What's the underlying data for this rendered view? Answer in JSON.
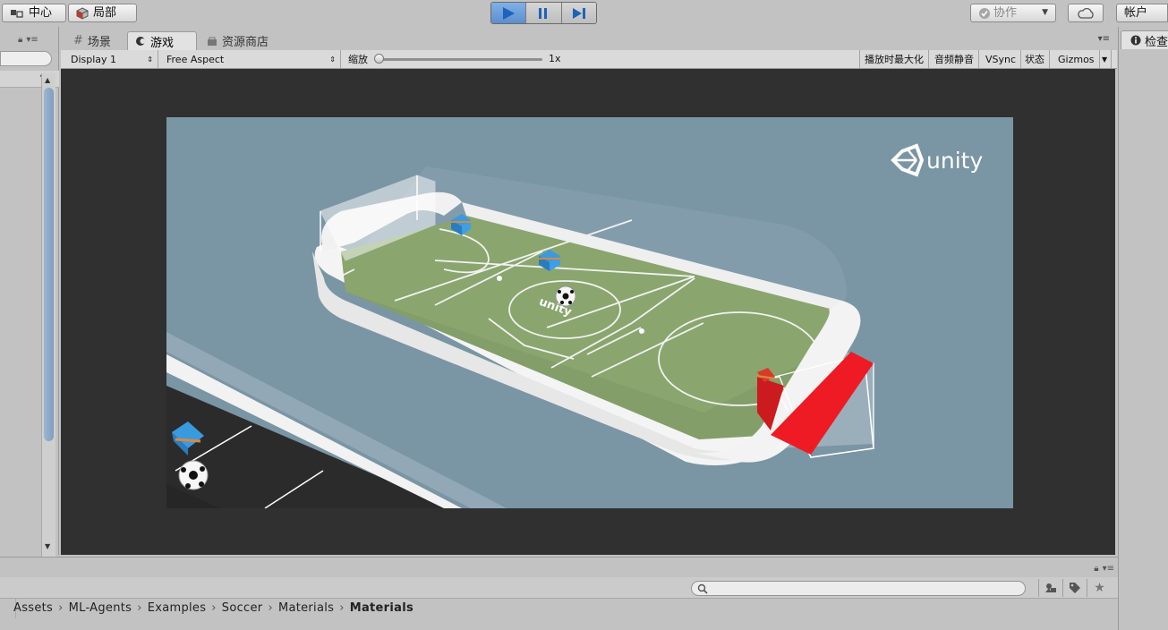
{
  "toolbar": {
    "pivot_label": "中心",
    "local_label": "局部",
    "collab_label": "协作",
    "account_label": "帐户"
  },
  "tabs": {
    "scene": "场景",
    "game": "游戏",
    "asset_store": "资源商店"
  },
  "right_panel": {
    "inspector_label": "检查"
  },
  "game_bar": {
    "display": "Display 1",
    "aspect": "Free Aspect",
    "scale_label": "缩放",
    "scale_value": "1x",
    "maximize_on_play": "播放时最大化",
    "mute_audio": "音频静音",
    "vsync": "VSync",
    "stats": "状态",
    "gizmos": "Gizmos"
  },
  "viewport": {
    "logo_text": "unity",
    "field_logo_text": "unity"
  },
  "breadcrumb": [
    "Assets",
    "ML-Agents",
    "Examples",
    "Soccer",
    "Materials",
    "Materials"
  ],
  "colors": {
    "play_active": "#5c8fd0",
    "sky": "#7a95a4",
    "field": "#8aa56e",
    "goal_red": "#ee1b24",
    "agent_blue": "#2f8fdc"
  },
  "icons": [
    "pivot-icon",
    "local-icon",
    "play-icon",
    "pause-icon",
    "step-icon",
    "check-icon",
    "cloud-icon",
    "lock-icon",
    "menu-icon",
    "grid-icon",
    "game-icon",
    "store-icon",
    "info-icon",
    "search-icon",
    "filter-icon",
    "label-icon",
    "star-icon"
  ]
}
